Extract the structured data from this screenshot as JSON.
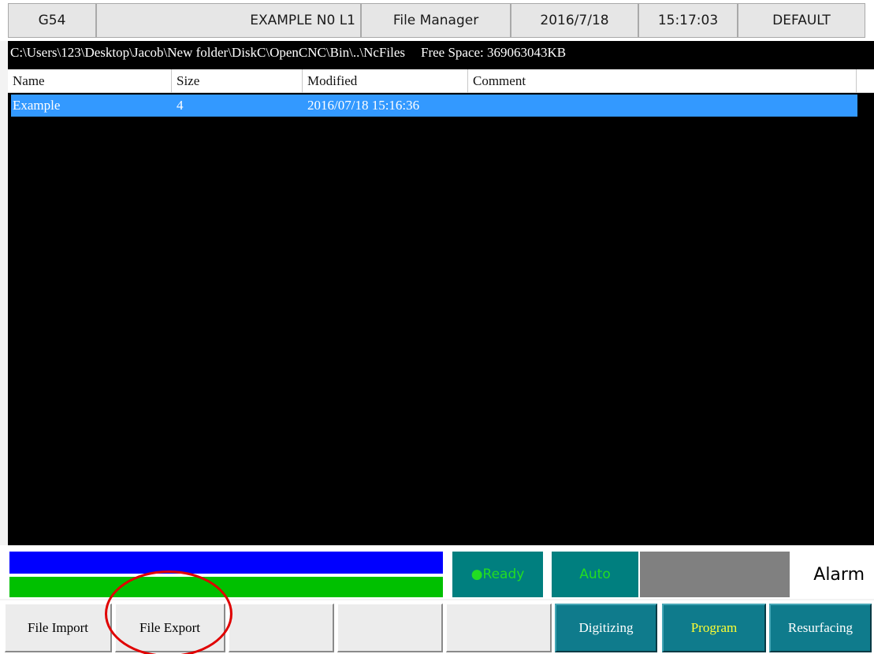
{
  "header": {
    "work_offset": "G54",
    "program": "EXAMPLE N0 L1",
    "screen": "File Manager",
    "date": "2016/7/18",
    "time": "15:17:03",
    "profile": "DEFAULT"
  },
  "pathbar": {
    "path": "C:\\Users\\123\\Desktop\\Jacob\\New folder\\DiskC\\OpenCNC\\Bin\\..\\NcFiles",
    "free_space": "Free Space: 369063043KB"
  },
  "filelist": {
    "columns": [
      "Name",
      "Size",
      "Modified",
      "Comment"
    ],
    "rows": [
      {
        "name": "Example",
        "size": "4",
        "modified": "2016/07/18 15:16:36",
        "comment": ""
      }
    ]
  },
  "status": {
    "ready": "●Ready",
    "mode": "Auto",
    "alarm": "Alarm"
  },
  "softkeys": {
    "file_import": "File Import",
    "file_export": "File Export",
    "blank3": "",
    "blank4": "",
    "digitizing": "Digitizing",
    "program": "Program",
    "resurfacing": "Resurfacing"
  },
  "colors": {
    "selection": "#3399ff",
    "status_teal": "#007f7f",
    "status_text_green": "#22dd22",
    "softkey_teal": "#0f7b8c",
    "highlight_red": "#e00000"
  }
}
